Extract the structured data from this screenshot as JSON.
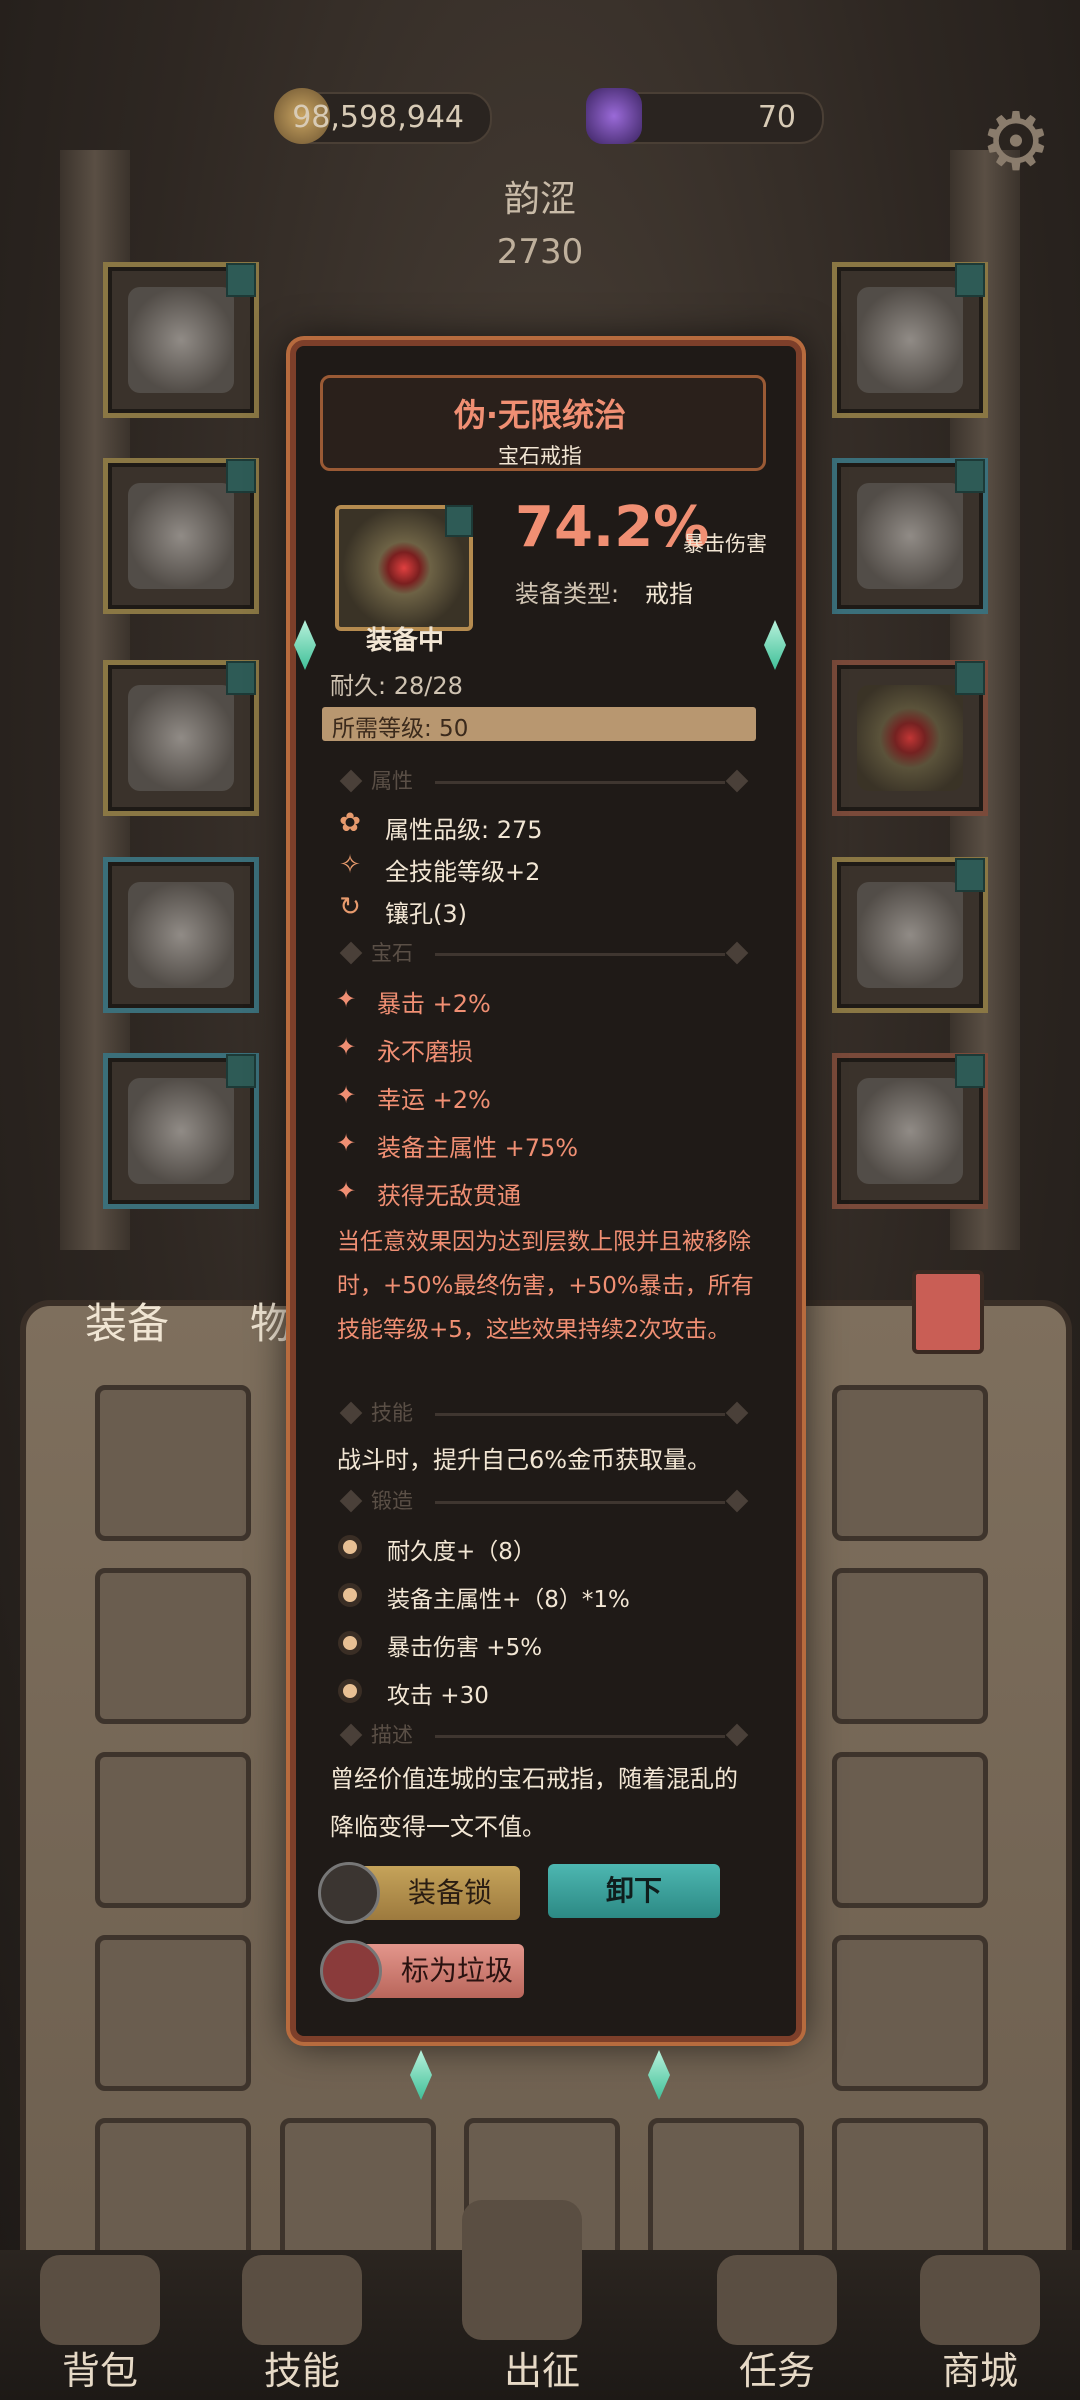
{
  "top_bar": {
    "gold": "98,598,944",
    "gems": "70",
    "settings_icon": "gear-icon"
  },
  "character": {
    "name": "韵涩",
    "level": "2730"
  },
  "bag_tabs": {
    "equipment": "装备",
    "items": "物品"
  },
  "popup": {
    "title": "伪·无限统治",
    "subtitle": "宝石戒指",
    "equipped": "装备中",
    "main_value": "74.2%",
    "main_stat": "暴击伤害",
    "type_label": "装备类型:",
    "type_value": "戒指",
    "durability": "耐久: 28/28",
    "required_level": "所需等级: 50",
    "section_attr": "属性",
    "attributes": [
      {
        "icon": "lotus-icon",
        "text": "属性品级: 275"
      },
      {
        "icon": "spark-icon",
        "text": "全技能等级+2"
      },
      {
        "icon": "cycle-icon",
        "text": "镶孔(3)"
      }
    ],
    "section_gem": "宝石",
    "gems": [
      "暴击 +2%",
      "永不磨损",
      "幸运 +2%",
      "装备主属性 +75%",
      "获得无敌贯通"
    ],
    "gem_effect": "当任意效果因为达到层数上限并且被移除时，+50%最终伤害，+50%暴击，所有技能等级+5，这些效果持续2次攻击。",
    "section_skill": "技能",
    "skill": "战斗时，提升自己6%金币获取量。",
    "section_forge": "锻造",
    "forge": [
      "耐久度+（8）",
      "装备主属性+（8）*1%",
      "暴击伤害 +5%",
      "攻击 +30"
    ],
    "section_desc": "描述",
    "description": "曾经价值连城的宝石戒指，随着混乱的降临变得一文不值。",
    "buttons": {
      "lock": "装备锁",
      "unequip": "卸下",
      "junk": "标为垃圾"
    }
  },
  "nav": {
    "backpack": "背包",
    "skills": "技能",
    "battle": "出征",
    "quests": "任务",
    "shop": "商城"
  },
  "colors": {
    "accent_red": "#f08f73",
    "teal": "#2c8984",
    "gold": "#c5a35a"
  }
}
